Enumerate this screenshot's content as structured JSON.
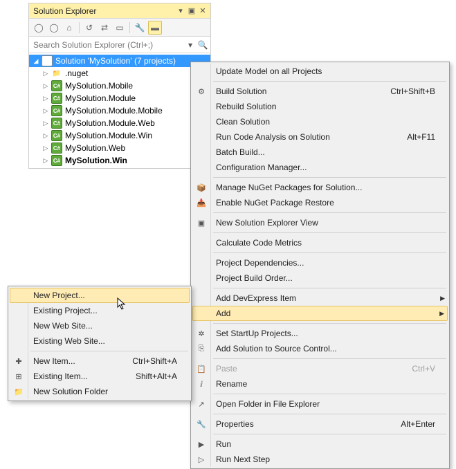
{
  "panel": {
    "title": "Solution Explorer",
    "search_placeholder": "Search Solution Explorer (Ctrl+;)"
  },
  "tree": {
    "root": "Solution 'MySolution' (7 projects)",
    "items": [
      {
        "label": ".nuget",
        "icon": "folder"
      },
      {
        "label": "MySolution.Mobile",
        "icon": "csproj"
      },
      {
        "label": "MySolution.Module",
        "icon": "csproj"
      },
      {
        "label": "MySolution.Module.Mobile",
        "icon": "csproj"
      },
      {
        "label": "MySolution.Module.Web",
        "icon": "csproj"
      },
      {
        "label": "MySolution.Module.Win",
        "icon": "csproj"
      },
      {
        "label": "MySolution.Web",
        "icon": "csproj"
      },
      {
        "label": "MySolution.Win",
        "icon": "csproj",
        "bold": true
      }
    ]
  },
  "menu": {
    "items": [
      {
        "label": "Update Model on all Projects"
      },
      {
        "sep": true
      },
      {
        "label": "Build Solution",
        "shortcut": "Ctrl+Shift+B",
        "icon": "build"
      },
      {
        "label": "Rebuild Solution"
      },
      {
        "label": "Clean Solution"
      },
      {
        "label": "Run Code Analysis on Solution",
        "shortcut": "Alt+F11"
      },
      {
        "label": "Batch Build..."
      },
      {
        "label": "Configuration Manager..."
      },
      {
        "sep": true
      },
      {
        "label": "Manage NuGet Packages for Solution...",
        "icon": "nuget"
      },
      {
        "label": "Enable NuGet Package Restore",
        "icon": "nuget-restore"
      },
      {
        "sep": true
      },
      {
        "label": "New Solution Explorer View",
        "icon": "new-view"
      },
      {
        "sep": true
      },
      {
        "label": "Calculate Code Metrics"
      },
      {
        "sep": true
      },
      {
        "label": "Project Dependencies..."
      },
      {
        "label": "Project Build Order..."
      },
      {
        "sep": true
      },
      {
        "label": "Add DevExpress Item",
        "submenu": true
      },
      {
        "label": "Add",
        "submenu": true,
        "highlight": true
      },
      {
        "sep": true
      },
      {
        "label": "Set StartUp Projects...",
        "icon": "startup"
      },
      {
        "label": "Add Solution to Source Control...",
        "icon": "source-control"
      },
      {
        "sep": true
      },
      {
        "label": "Paste",
        "shortcut": "Ctrl+V",
        "icon": "paste",
        "disabled": true
      },
      {
        "label": "Rename",
        "icon": "rename"
      },
      {
        "sep": true
      },
      {
        "label": "Open Folder in File Explorer",
        "icon": "folder-open"
      },
      {
        "sep": true
      },
      {
        "label": "Properties",
        "shortcut": "Alt+Enter",
        "icon": "wrench"
      },
      {
        "sep": true
      },
      {
        "label": "Run",
        "icon": "run"
      },
      {
        "label": "Run Next Step",
        "icon": "run-step"
      }
    ]
  },
  "submenu": {
    "items": [
      {
        "label": "New Project...",
        "highlight": true
      },
      {
        "label": "Existing Project..."
      },
      {
        "label": "New Web Site..."
      },
      {
        "label": "Existing Web Site..."
      },
      {
        "sep": true
      },
      {
        "label": "New Item...",
        "shortcut": "Ctrl+Shift+A",
        "icon": "new-item"
      },
      {
        "label": "Existing Item...",
        "shortcut": "Shift+Alt+A",
        "icon": "existing-item"
      },
      {
        "label": "New Solution Folder",
        "icon": "new-folder"
      }
    ]
  },
  "icons": {
    "cs": "C#"
  }
}
